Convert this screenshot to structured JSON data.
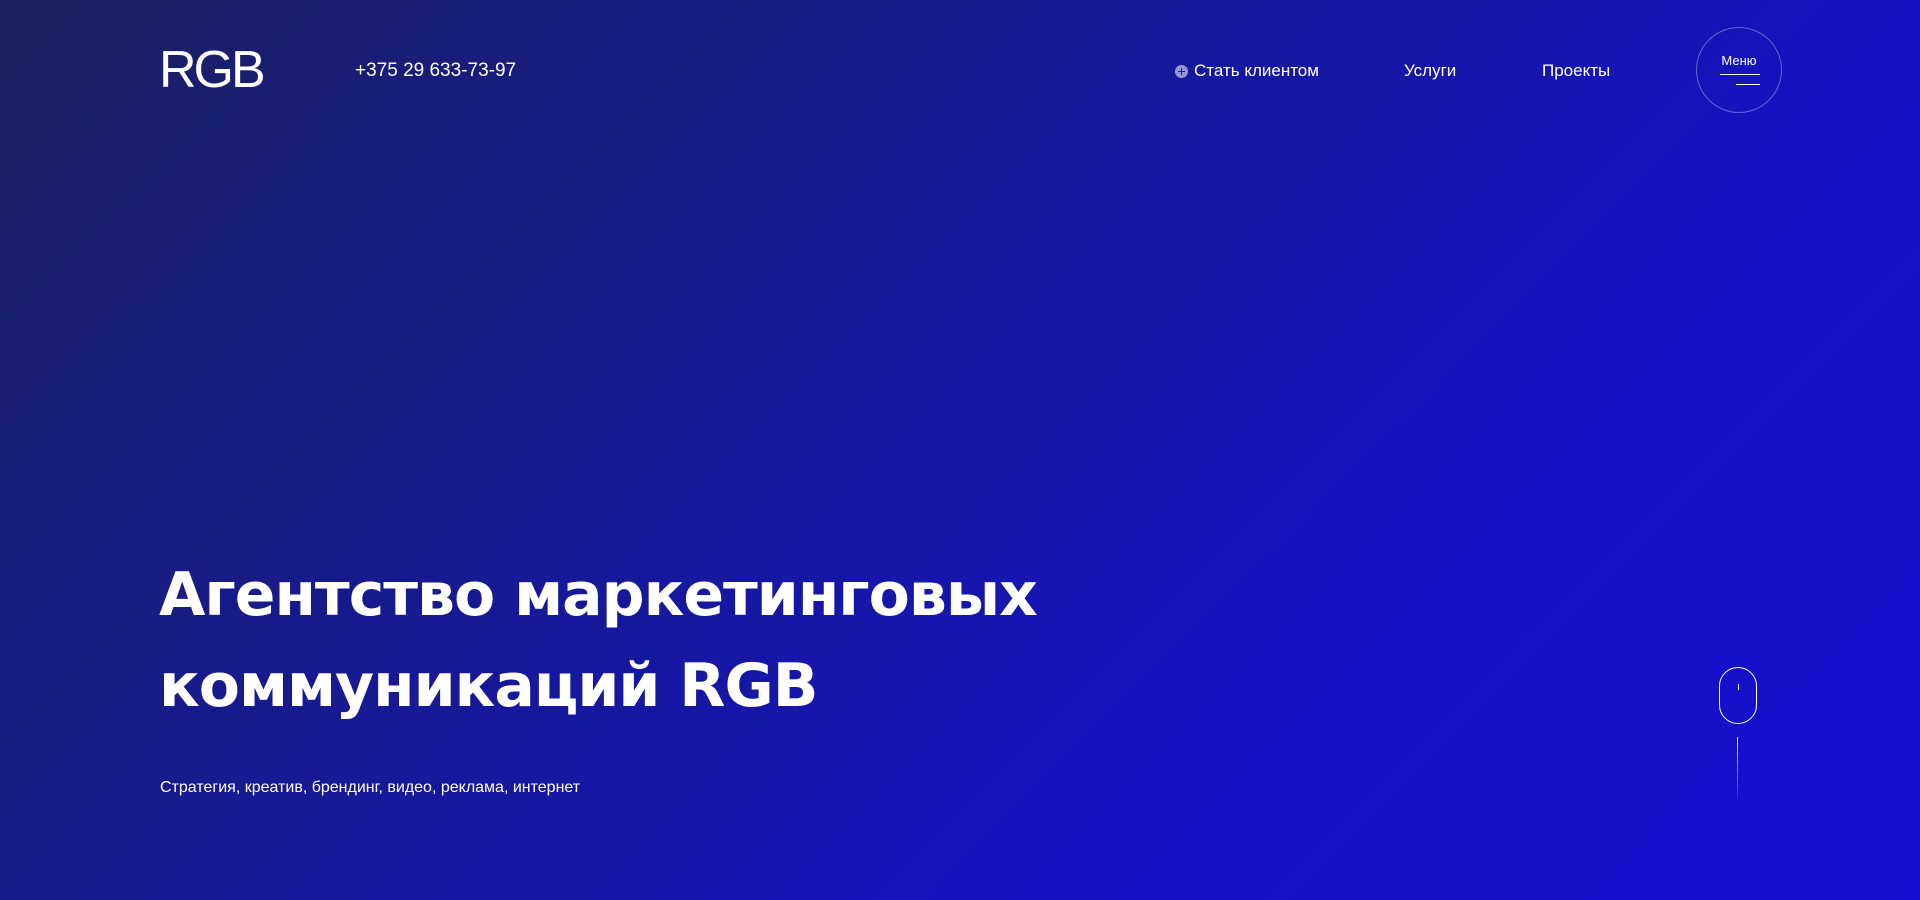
{
  "header": {
    "logo": "RGB",
    "phone": "+375 29 633-73-97",
    "nav": {
      "become_client": "Стать клиентом",
      "services": "Услуги",
      "projects": "Проекты"
    },
    "menu_label": "Меню"
  },
  "hero": {
    "title_line1": "Агентство маркетинговых",
    "title_line2": "коммуникаций RGB",
    "subtitle": "Стратегия, креатив, брендинг, видео, реклама, интернет"
  },
  "icons": {
    "become_client": "plus-circle-icon",
    "menu": "burger-icon",
    "scroll": "mouse-scroll-icon"
  },
  "colors": {
    "background_start": "#1a2160",
    "background_end": "#150fcf",
    "text": "#ffffff"
  }
}
